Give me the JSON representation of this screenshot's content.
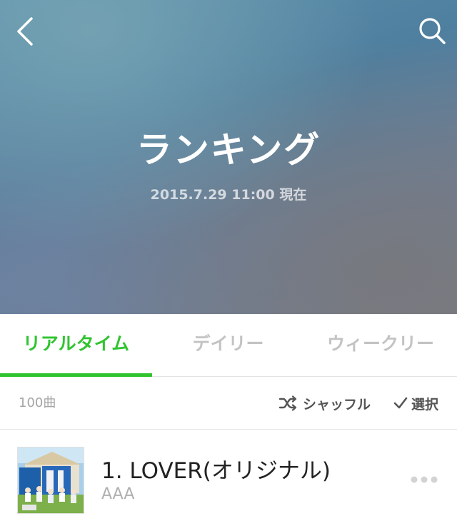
{
  "header": {
    "title": "ランキング",
    "subtitle": "2015.7.29 11:00 現在",
    "back_icon": "chevron-left-icon",
    "search_icon": "search-icon"
  },
  "tabs": [
    {
      "label": "リアルタイム",
      "active": true
    },
    {
      "label": "デイリー",
      "active": false
    },
    {
      "label": "ウィークリー",
      "active": false
    }
  ],
  "toolbar": {
    "count": "100曲",
    "shuffle_label": "シャッフル",
    "select_label": "選択"
  },
  "tracks": [
    {
      "title": "1. LOVER(オリジナル)",
      "artist": "AAA"
    }
  ],
  "colors": {
    "accent": "#2fc42f",
    "tab_inactive": "#c3c3c3",
    "text_primary": "#222222",
    "text_secondary": "#b0b0b0"
  }
}
